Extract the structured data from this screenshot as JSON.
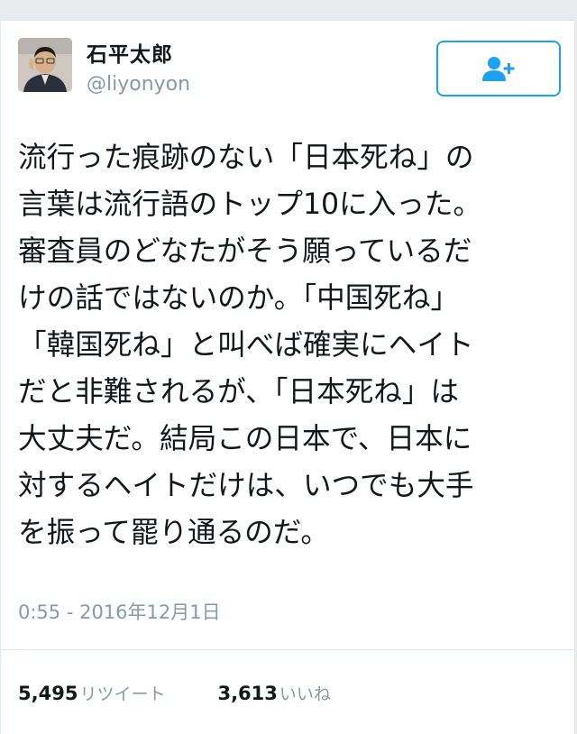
{
  "tweet": {
    "author": {
      "display_name": "石平太郎",
      "screen_name": "@liyonyon"
    },
    "follow_button": {
      "icon": "follow-user-plus-icon"
    },
    "text_lines": [
      "流行った痕跡のない「日本死ね」の",
      "言葉は流行語のトップ10に入った。",
      "審査員のどなたがそう願っているだ",
      "けの話ではないのか。「中国死ね」",
      "「韓国死ね」と叫べば確実にヘイト",
      "だと非難されるが、「日本死ね」は",
      "大丈夫だ。結局この日本で、日本に",
      "対するヘイトだけは、いつでも大手",
      "を振って罷り通るのだ。"
    ],
    "timestamp": "0:55 - 2016年12月1日",
    "stats": {
      "retweets_count": "5,495",
      "retweets_label": "リツイート",
      "likes_count": "3,613",
      "likes_label": "いいね"
    }
  },
  "colors": {
    "accent": "#1da1f2",
    "text": "#14171a",
    "muted": "#8899a6",
    "divider": "#e1e8ed"
  }
}
